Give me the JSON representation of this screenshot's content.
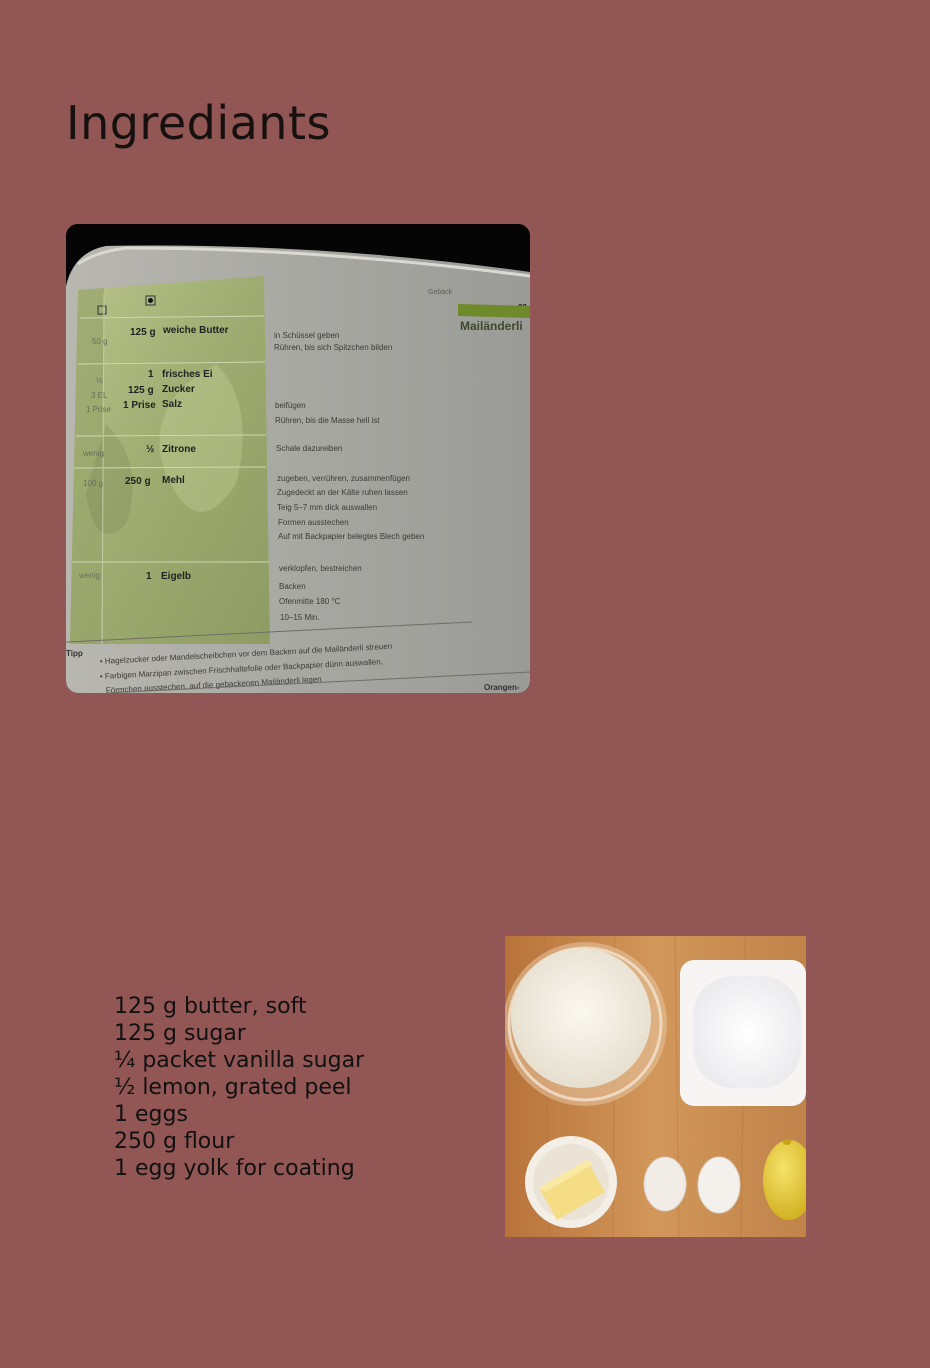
{
  "page": {
    "title": "Ingrediants"
  },
  "ingredients": [
    "125 g butter, soft",
    "125 g sugar",
    "¼ packet vanilla sugar",
    "½ lemon, grated peel",
    "1 eggs",
    "250 g flour",
    "1 egg yolk for coating"
  ],
  "book_photo": {
    "header_section": "Gebäck",
    "page_number": "29",
    "recipe_title": "Mailänderli",
    "rows": [
      {
        "small": "50 g",
        "amount": "125 g",
        "item": "weiche Butter",
        "steps": [
          "in Schüssel geben",
          "Rühren, bis sich Spitzchen bilden"
        ]
      },
      {
        "small": "½",
        "amount": "1",
        "item": "frisches Ei",
        "steps": []
      },
      {
        "small": "3 EL",
        "amount": "125 g",
        "item": "Zucker",
        "steps": []
      },
      {
        "small": "1 Prise",
        "amount": "1 Prise",
        "item": "Salz",
        "steps": [
          "beifügen",
          "Rühren, bis die Masse hell ist"
        ]
      },
      {
        "small": "wenig",
        "amount": "½",
        "item": "Zitrone",
        "steps": [
          "Schale dazureiben"
        ]
      },
      {
        "small": "100 g",
        "amount": "250 g",
        "item": "Mehl",
        "steps": [
          "zugeben, verrühren, zusammenfügen",
          "Zugedeckt an der Kälte ruhen lassen",
          "Teig 5–7 mm dick auswallen",
          "Formen ausstechen",
          "Auf mit Backpapier belegtes Blech geben"
        ]
      },
      {
        "small": "wenig",
        "amount": "1",
        "item": "Eigelb",
        "steps": [
          "verklopfen, bestreichen",
          "Backen",
          "Ofenmitte 180 °C",
          "10–15 Min."
        ]
      }
    ],
    "tip_label": "Tipp",
    "tips": [
      "• Hagelzucker oder Mandelscheibchen vor dem Backen auf die Mailänderli streuen",
      "• Farbigen Marzipan zwischen Frischhaltefolie oder Backpapier dünn auswallen,",
      "Förmchen ausstechen, auf die gebackenen Mailänderli legen"
    ],
    "next_recipe_label": "Orangen-"
  },
  "colors": {
    "background": "#925654",
    "text": "#111111",
    "book_green": "#aab67e",
    "wood": "#c98a4b"
  }
}
